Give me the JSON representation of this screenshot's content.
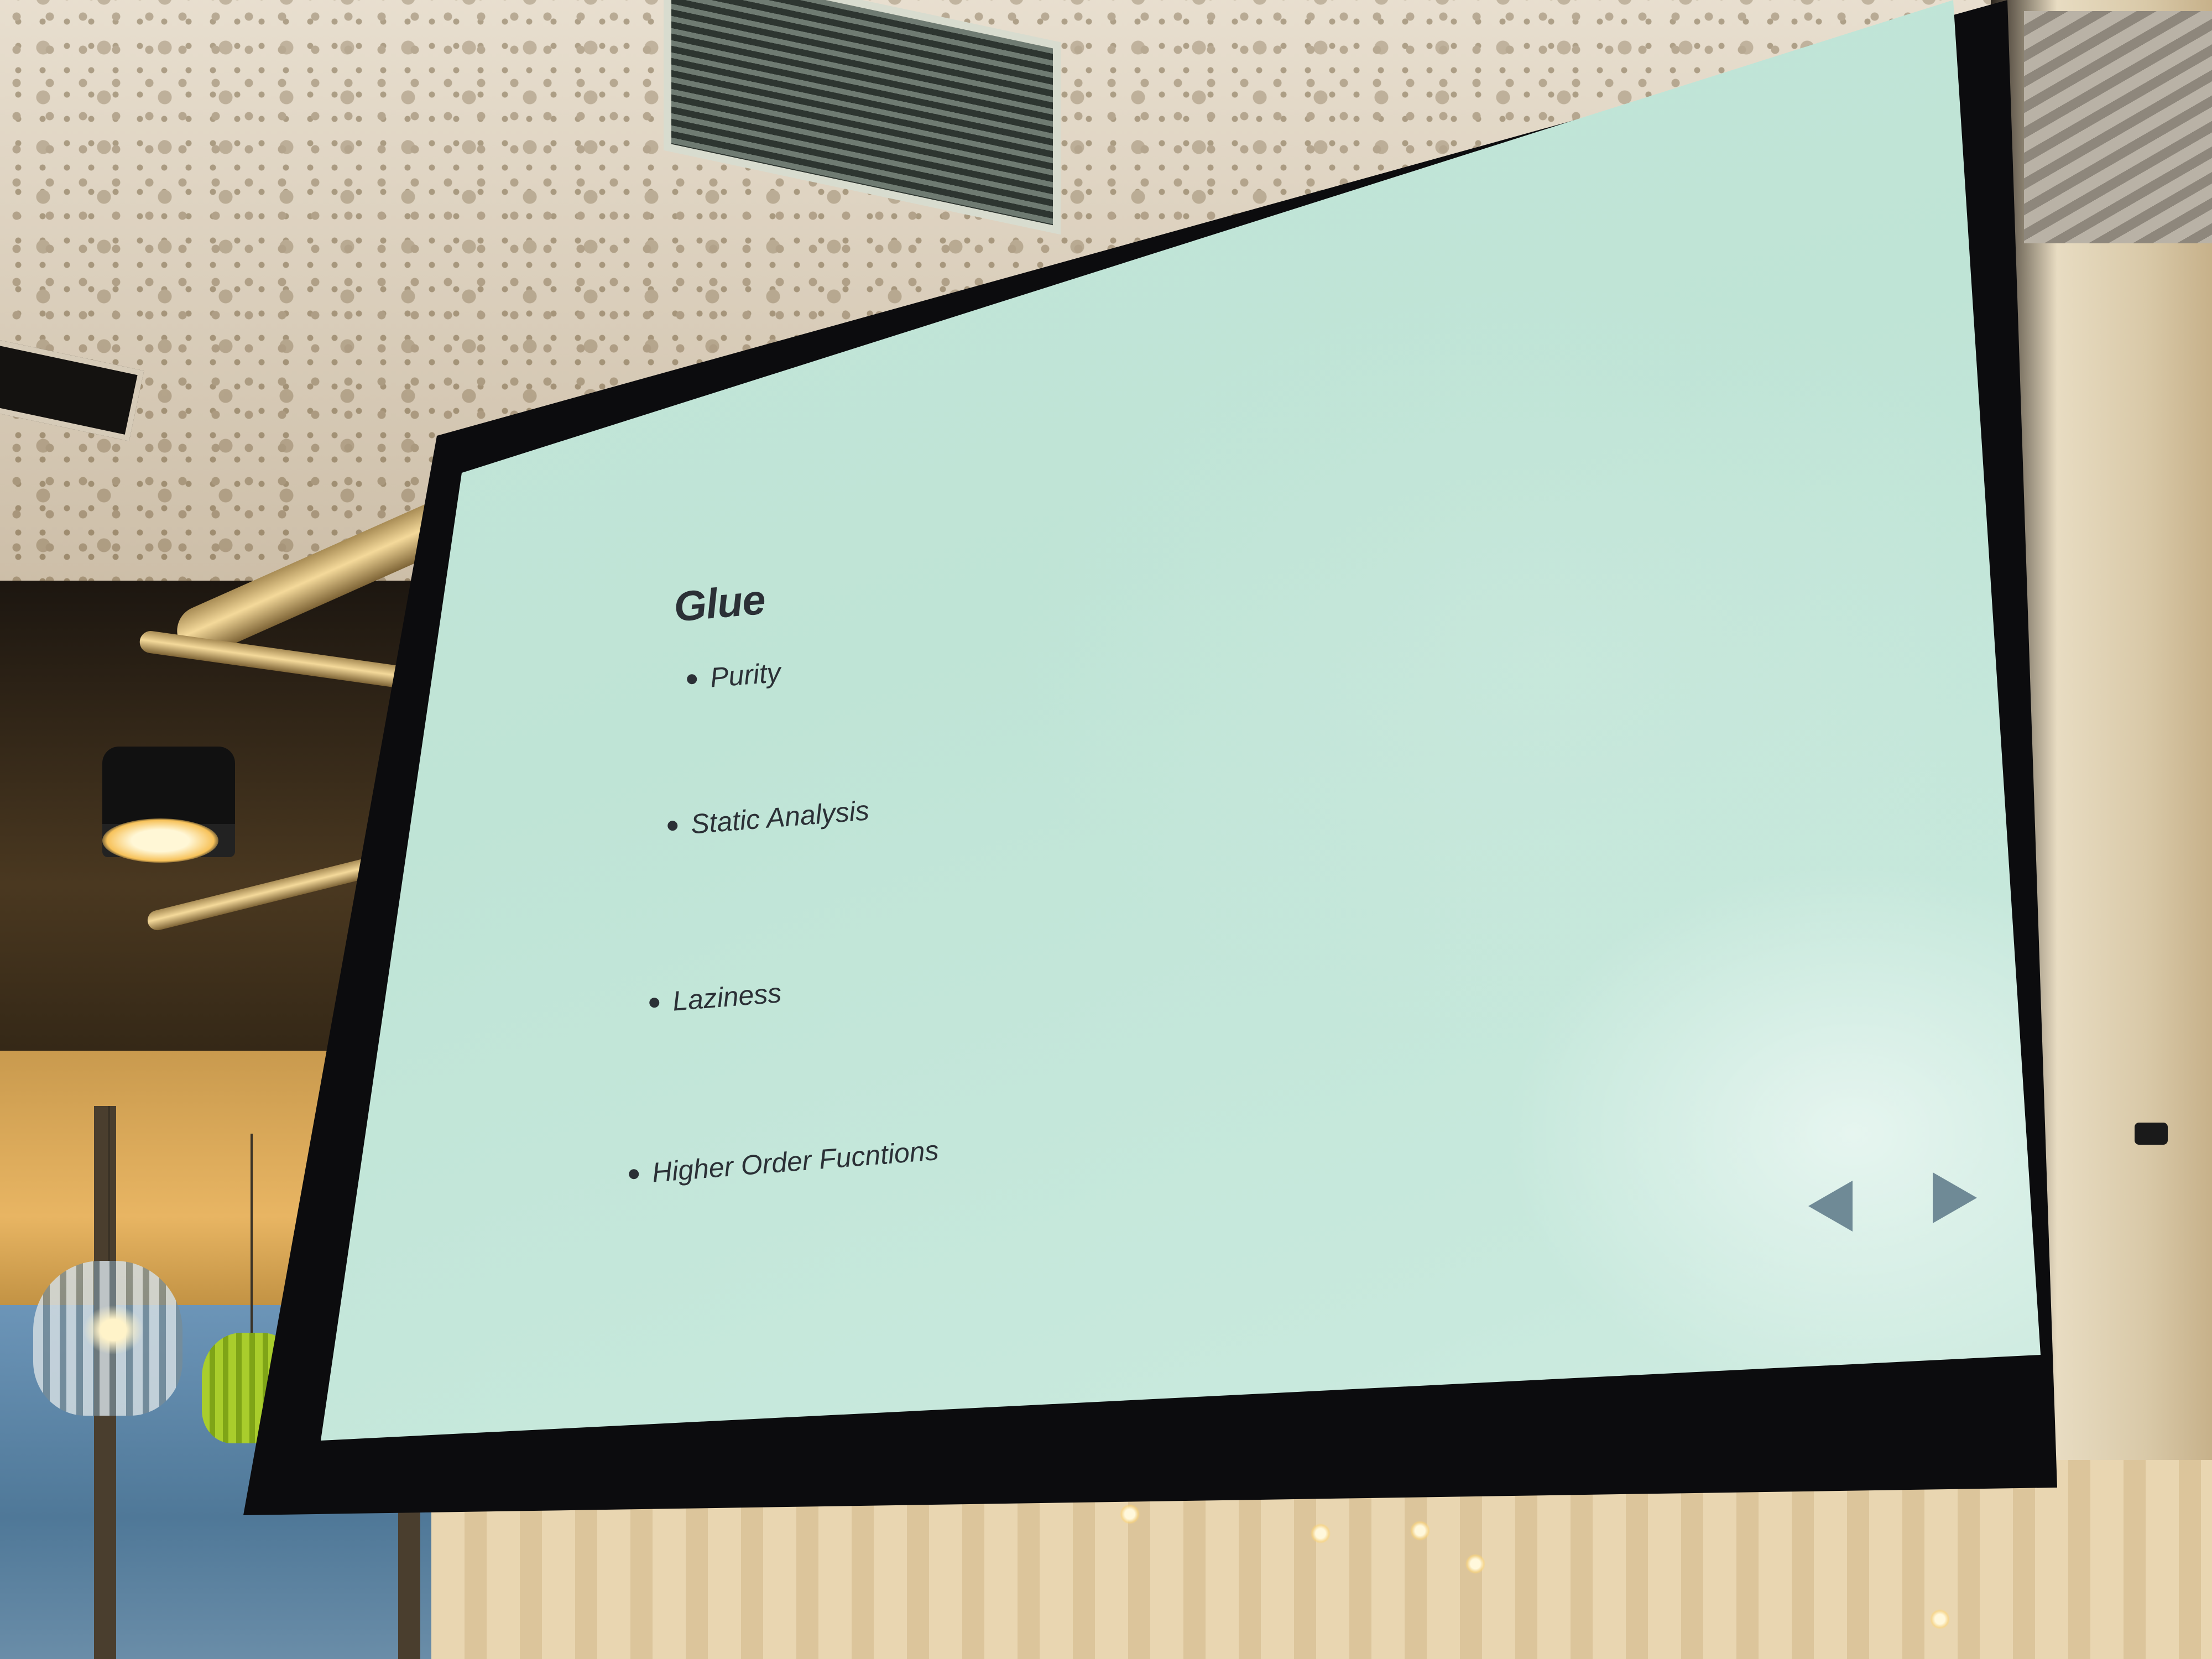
{
  "slide": {
    "title": "Glue",
    "bullets": [
      "Purity",
      "Static Analysis",
      "Laziness",
      "Higher Order Fucntions"
    ]
  },
  "navigation": {
    "prev_icon": "triangle-left-icon",
    "next_icon": "triangle-right-icon"
  },
  "colors": {
    "screen": "#c4e6d9",
    "text": "#2b3036",
    "nav_arrow": "#6f8a96",
    "screen_frame": "#0c0c0e"
  }
}
